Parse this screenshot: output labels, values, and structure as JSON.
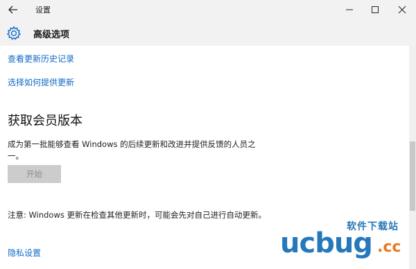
{
  "window": {
    "title": "设置"
  },
  "header": {
    "title": "高级选项"
  },
  "links": {
    "history": "查看更新历史记录",
    "choose": "选择如何提供更新",
    "privacy": "隐私设置"
  },
  "insider": {
    "section_title": "获取会员版本",
    "description": "成为第一批能够查看 Windows 的后续更新和改进并提供反馈的人员之一。",
    "start_label": "开始"
  },
  "note": "注意: Windows 更新在检查其他更新时，可能会先对自己进行自动更新。",
  "watermark": {
    "top": "软件下载站",
    "main": "ucbug",
    "suffix": ".cc"
  },
  "colors": {
    "link": "#1069c7",
    "titlebar_bg": "#f2f2f2",
    "disabled_button": "#cccccc",
    "watermark_blue": "#2678bb",
    "watermark_orange": "#e77a1c"
  },
  "icons": {
    "back": "back-arrow-icon",
    "settings": "gear-icon",
    "minimize": "minimize-icon",
    "maximize": "maximize-icon",
    "close": "close-icon"
  }
}
